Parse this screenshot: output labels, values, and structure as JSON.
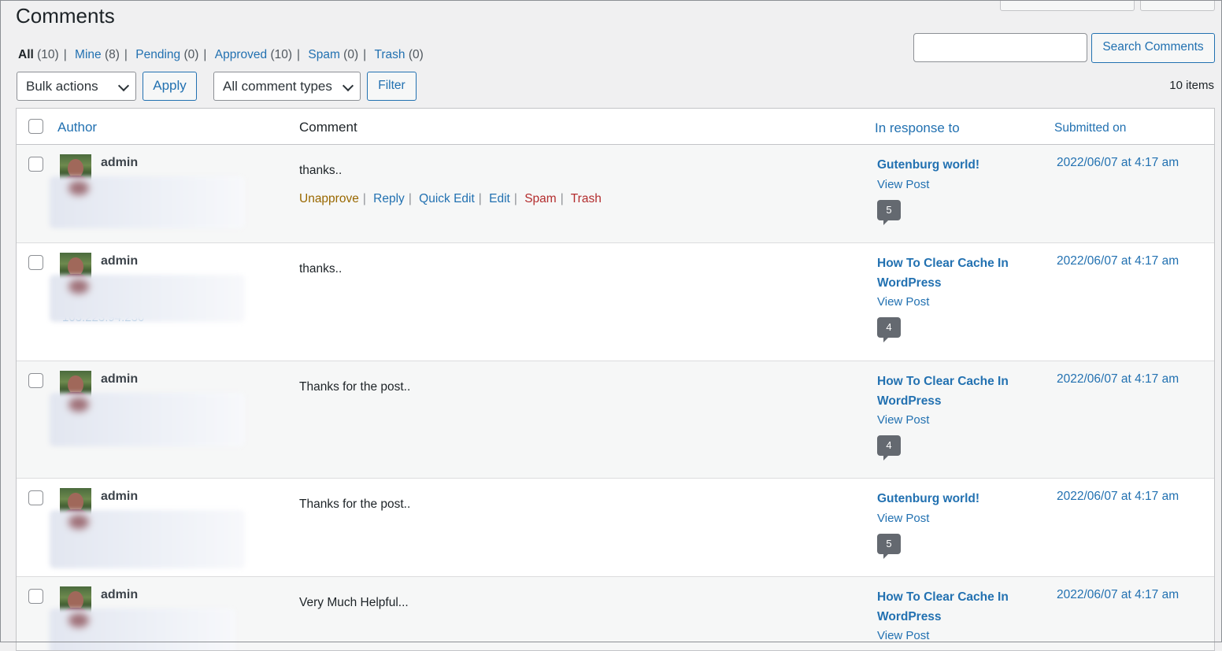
{
  "page": {
    "title": "Comments"
  },
  "filters": [
    {
      "label": "All",
      "count": "(10)",
      "current": true
    },
    {
      "label": "Mine",
      "count": "(8)"
    },
    {
      "label": "Pending",
      "count": "(0)"
    },
    {
      "label": "Approved",
      "count": "(10)"
    },
    {
      "label": "Spam",
      "count": "(0)"
    },
    {
      "label": "Trash",
      "count": "(0)"
    }
  ],
  "search": {
    "value": "",
    "button_label": "Search Comments"
  },
  "toolbar": {
    "bulk_label": "Bulk actions",
    "apply_label": "Apply",
    "type_label": "All comment types",
    "filter_label": "Filter",
    "items_count": "10 items"
  },
  "table": {
    "columns": {
      "author": "Author",
      "comment": "Comment",
      "response": "In response to",
      "submitted": "Submitted on"
    },
    "rows": [
      {
        "author": "admin",
        "comment": "thanks..",
        "actions": [
          "Unapprove",
          "Reply",
          "Quick Edit",
          "Edit",
          "Spam",
          "Trash"
        ],
        "response_title": "Gutenburg world!",
        "view_post": "View Post",
        "comment_count": "5",
        "date": "2022/06/07 at 4:17 am"
      },
      {
        "author": "admin",
        "ip_fragment": "103.223.94.236",
        "comment": "thanks..",
        "response_title": "How To Clear Cache In WordPress",
        "view_post": "View Post",
        "comment_count": "4",
        "date": "2022/06/07 at 4:17 am"
      },
      {
        "author": "admin",
        "comment": "Thanks for the post..",
        "response_title": "How To Clear Cache In WordPress",
        "view_post": "View Post",
        "comment_count": "4",
        "date": "2022/06/07 at 4:17 am"
      },
      {
        "author": "admin",
        "comment": "Thanks for the post..",
        "response_title": "Gutenburg world!",
        "view_post": "View Post",
        "comment_count": "5",
        "date": "2022/06/07 at 4:17 am"
      },
      {
        "author": "admin",
        "comment": "Very Much Helpful...",
        "response_title": "How To Clear Cache In WordPress",
        "view_post": "View Post",
        "date": "2022/06/07 at 4:17 am"
      }
    ]
  }
}
